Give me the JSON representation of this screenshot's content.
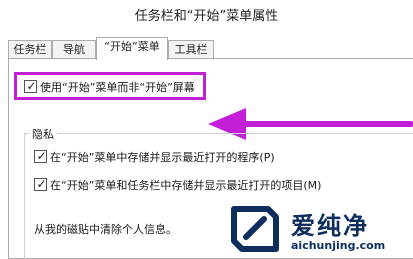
{
  "window": {
    "title": "任务栏和“开始”菜单属性"
  },
  "tabs": [
    {
      "label": "任务栏"
    },
    {
      "label": "导航"
    },
    {
      "label": "“开始”菜单"
    },
    {
      "label": "工具栏"
    }
  ],
  "active_tab_index": 2,
  "start_menu": {
    "use_start_instead_label": "使用“开始”菜单而非“开始”屏幕",
    "use_start_instead_checked": true
  },
  "privacy": {
    "group_label": "隐私",
    "option1_label": "在“开始”菜单中存储并显示最近打开的程序(P)",
    "option1_checked": true,
    "option2_label": "在“开始”菜单和任务栏中存储并显示最近打开的项目(M)",
    "option2_checked": true,
    "clear_info_text": "从我的磁贴中清除个人信息。"
  },
  "annotation": {
    "highlight_color": "#c21fd6",
    "arrow_color": "#c21fd6"
  },
  "watermark": {
    "brand_text": "爱纯净",
    "url_text": "aichunjing.com",
    "color": "#0c2d5e"
  }
}
